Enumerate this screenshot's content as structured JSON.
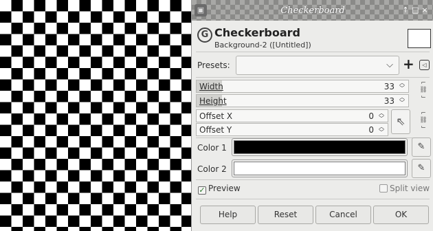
{
  "window": {
    "title": "Checkerboard",
    "controls": [
      "↑",
      "□",
      "×"
    ]
  },
  "header": {
    "title": "Checkerboard",
    "subtitle": "Background-2 ([Untitled])",
    "icon": "gimp-filter-icon"
  },
  "presets": {
    "label": "Presets:",
    "value": "",
    "add_icon": "+",
    "menu_icon": "◁"
  },
  "fields": {
    "width": {
      "label": "Width",
      "value": "33",
      "fill_fraction": 0.12
    },
    "height": {
      "label": "Height",
      "value": "33",
      "fill_fraction": 0.12
    },
    "offset_x": {
      "label": "Offset X",
      "value": "0"
    },
    "offset_y": {
      "label": "Offset Y",
      "value": "0"
    }
  },
  "colors": {
    "color1": {
      "label": "Color 1",
      "value": "#000000"
    },
    "color2": {
      "label": "Color 2",
      "value": "#ffffff"
    }
  },
  "options": {
    "preview": {
      "label": "Preview",
      "checked": true
    },
    "split_view": {
      "label": "Split view",
      "checked": false
    }
  },
  "buttons": {
    "help": "Help",
    "reset": "Reset",
    "cancel": "Cancel",
    "ok": "OK"
  }
}
